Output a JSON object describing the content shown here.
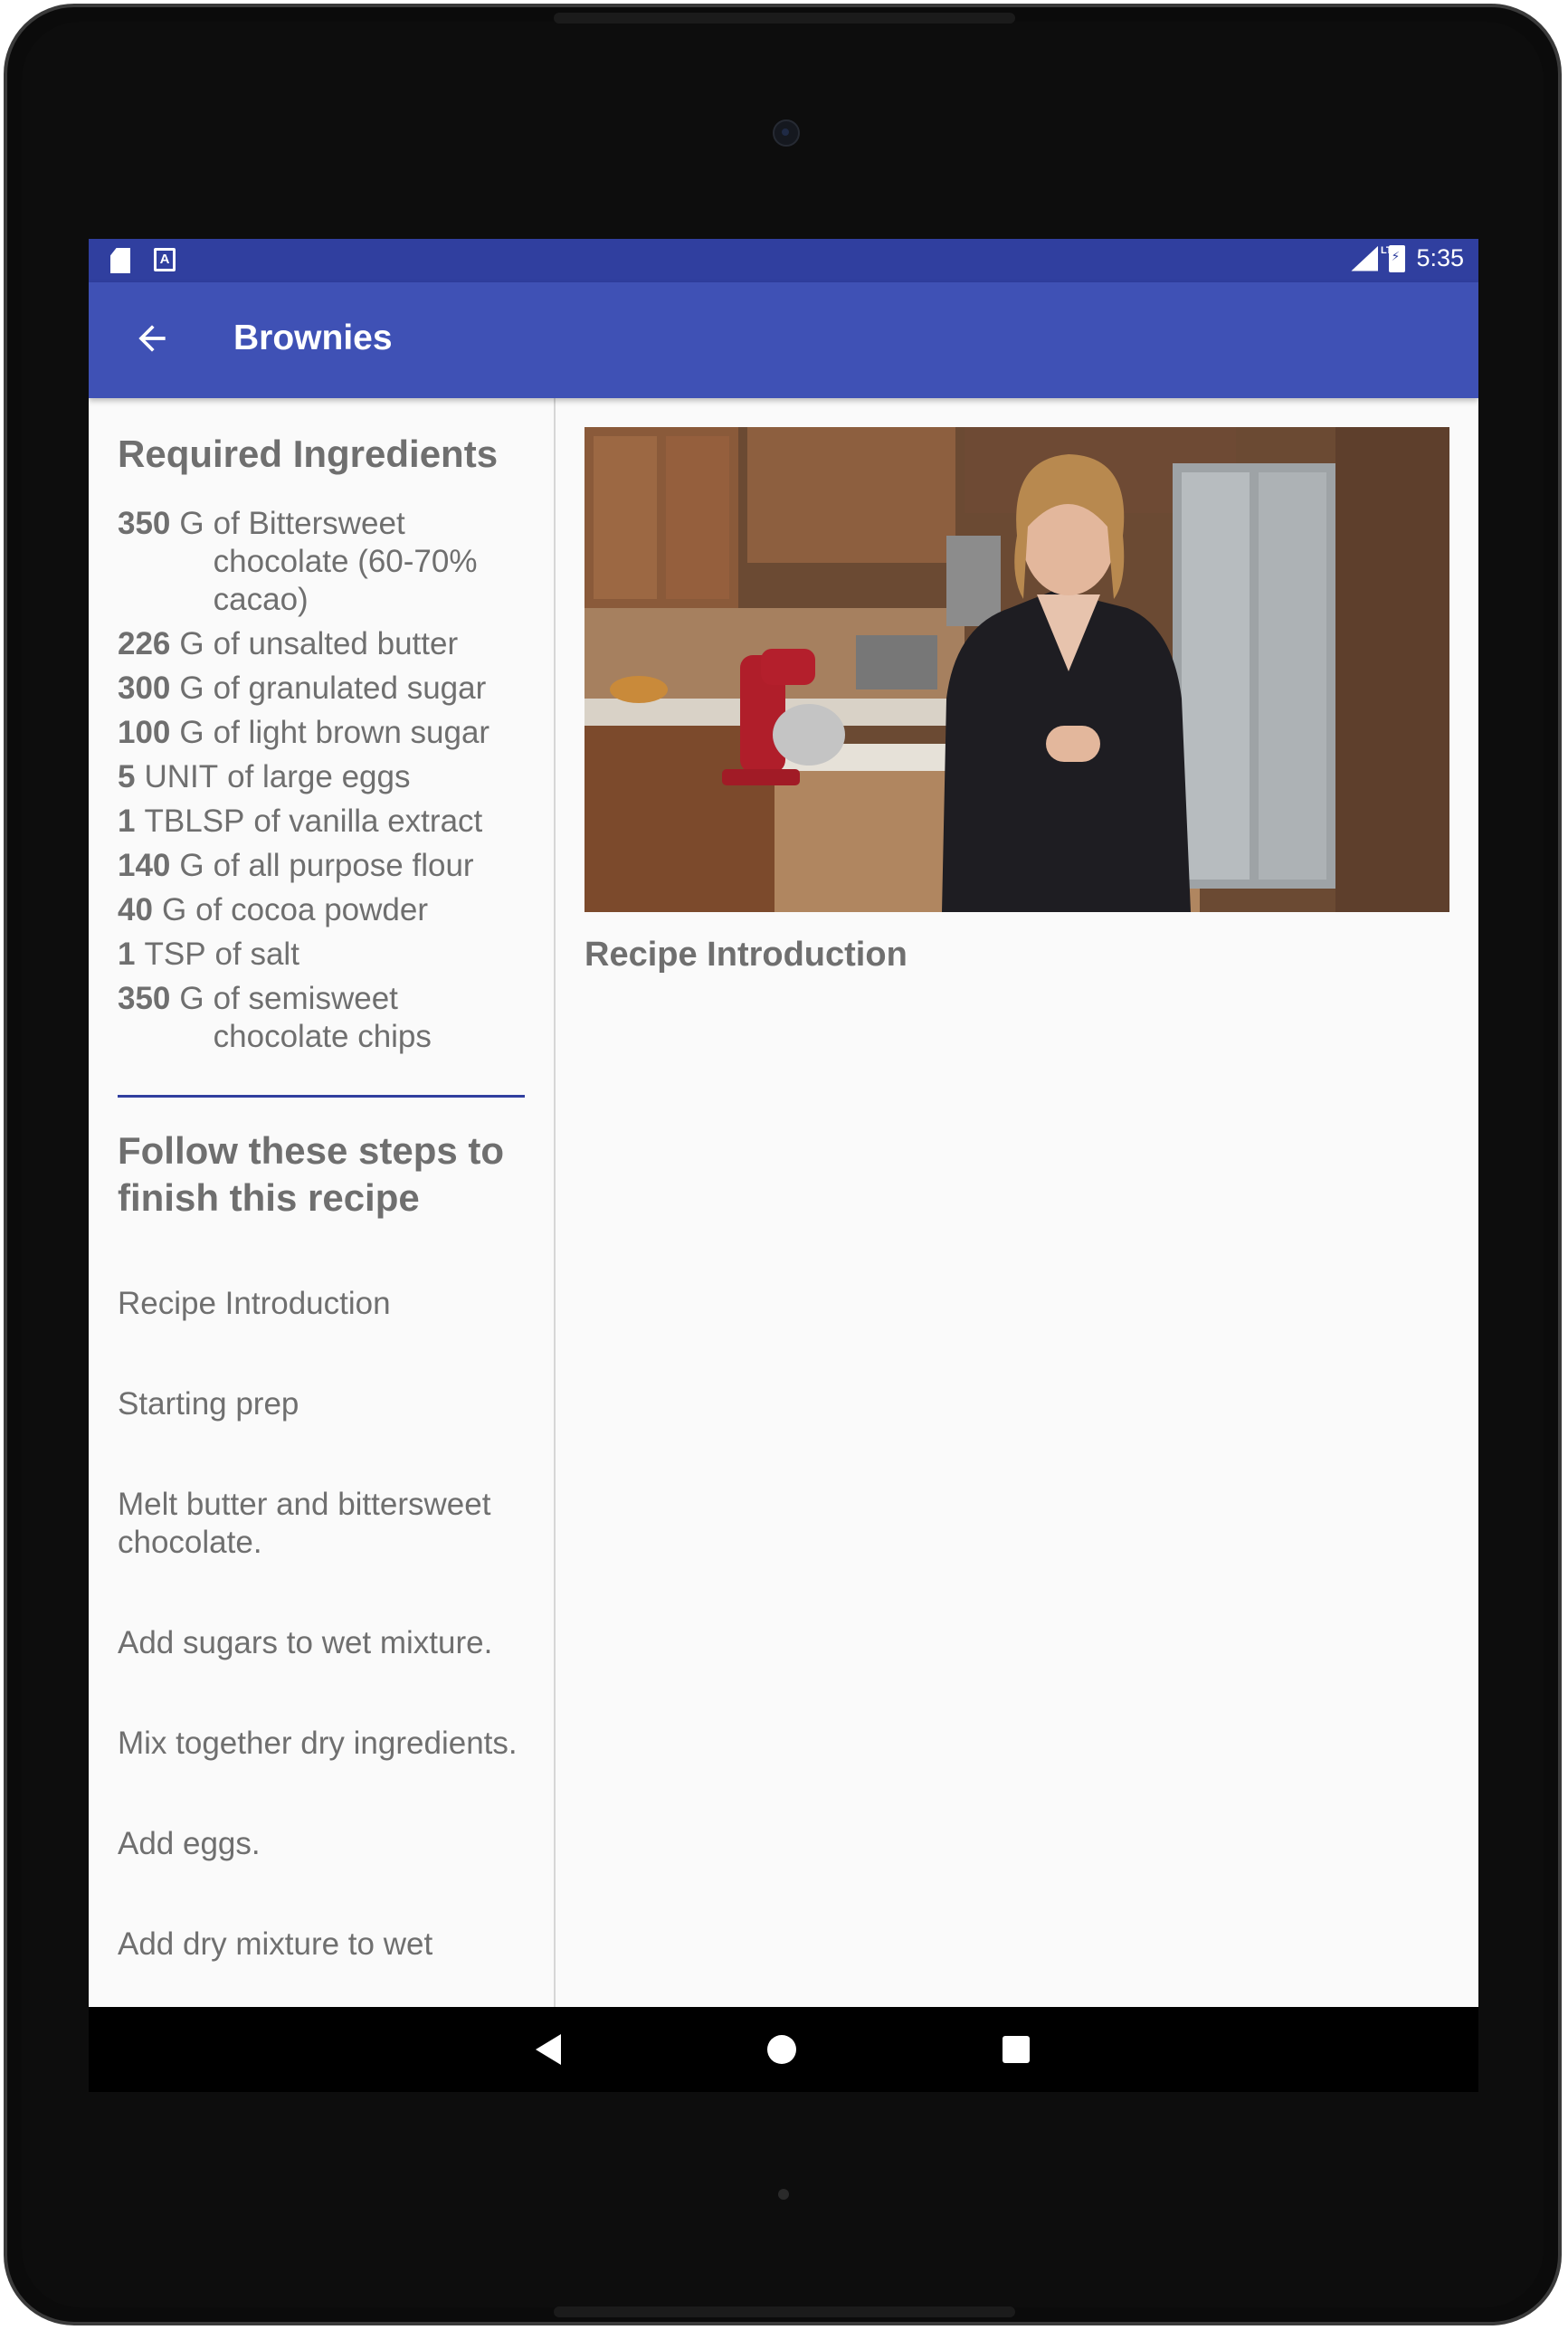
{
  "status_bar": {
    "time": "5:35",
    "network": "LTE"
  },
  "app_bar": {
    "title": "Brownies"
  },
  "ingredients": {
    "heading": "Required Ingredients",
    "items": [
      {
        "qty": "350",
        "unit": "G",
        "name": "of Bittersweet chocolate (60-70% cacao)"
      },
      {
        "qty": "226",
        "unit": "G",
        "name": "of unsalted butter"
      },
      {
        "qty": "300",
        "unit": "G",
        "name": "of granulated sugar"
      },
      {
        "qty": "100",
        "unit": "G",
        "name": "of light brown sugar"
      },
      {
        "qty": "5",
        "unit": "UNIT",
        "name": "of large eggs"
      },
      {
        "qty": "1",
        "unit": "TBLSP",
        "name": "of vanilla extract"
      },
      {
        "qty": "140",
        "unit": "G",
        "name": "of all purpose flour"
      },
      {
        "qty": "40",
        "unit": "G",
        "name": "of cocoa powder"
      },
      {
        "qty": "1",
        "unit": "TSP",
        "name": "of salt"
      },
      {
        "qty": "350",
        "unit": "G",
        "name": "of semisweet chocolate chips"
      }
    ]
  },
  "steps": {
    "heading": "Follow these steps to finish this recipe",
    "items": [
      "Recipe Introduction",
      "Starting prep",
      "Melt butter and bittersweet chocolate.",
      "Add sugars to wet mixture.",
      "Mix together dry ingredients.",
      "Add eggs.",
      "Add dry mixture to wet"
    ]
  },
  "detail": {
    "step_title": "Recipe Introduction"
  },
  "colors": {
    "primary": "#3f51b5",
    "primary_dark": "#303f9f",
    "text": "#6f6f6f"
  }
}
